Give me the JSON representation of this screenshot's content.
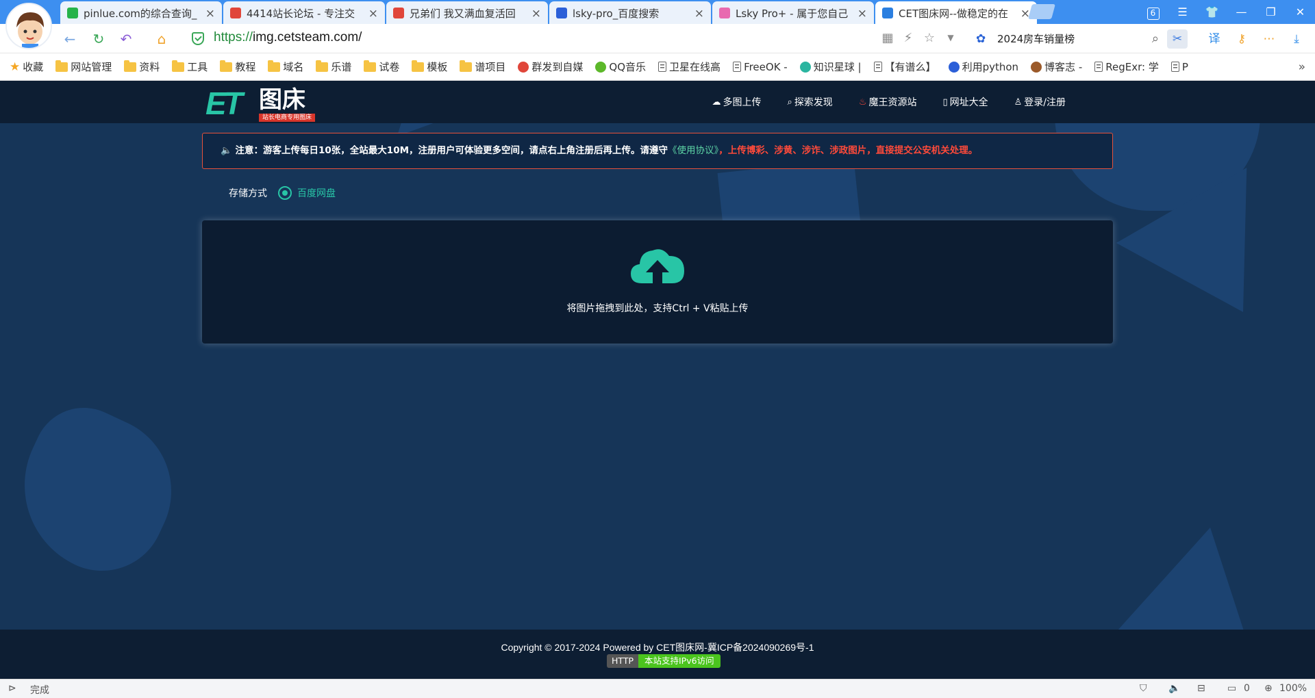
{
  "browser": {
    "tabs": [
      {
        "label": "pinlue.com的综合查询_",
        "icon_color": "#27b34a",
        "active": false
      },
      {
        "label": "4414站长论坛 - 专注交",
        "icon_color": "#e0463a",
        "active": false
      },
      {
        "label": "兄弟们 我又满血复活回",
        "icon_color": "#e0463a",
        "active": false
      },
      {
        "label": "lsky-pro_百度搜索",
        "icon_color": "#2b5fd8",
        "active": false
      },
      {
        "label": "Lsky Pro+ - 属于您自己",
        "icon_color": "#e86ab0",
        "active": false
      },
      {
        "label": "CET图床网--做稳定的在",
        "icon_color": "#2b7fe0",
        "active": true
      }
    ],
    "tab_count_badge": "6",
    "url_scheme": "https://",
    "url_rest": "img.cetsteam.com/",
    "search_suggestion": "2024房车销量榜",
    "bookmarks": [
      {
        "label": "收藏",
        "icon": "star"
      },
      {
        "label": "网站管理",
        "icon": "folder"
      },
      {
        "label": "资料",
        "icon": "folder"
      },
      {
        "label": "工具",
        "icon": "folder"
      },
      {
        "label": "教程",
        "icon": "folder"
      },
      {
        "label": "域名",
        "icon": "folder"
      },
      {
        "label": "乐谱",
        "icon": "folder"
      },
      {
        "label": "试卷",
        "icon": "folder"
      },
      {
        "label": "模板",
        "icon": "folder"
      },
      {
        "label": "谱项目",
        "icon": "folder"
      },
      {
        "label": "群发到自媒",
        "icon": "dot-red"
      },
      {
        "label": "QQ音乐",
        "icon": "dot-green"
      },
      {
        "label": "卫星在线高",
        "icon": "doc"
      },
      {
        "label": "FreeOK -",
        "icon": "doc"
      },
      {
        "label": "知识星球 |",
        "icon": "dot-teal"
      },
      {
        "label": "【有谱么】",
        "icon": "doc"
      },
      {
        "label": "利用python",
        "icon": "dot-blue"
      },
      {
        "label": "博客志 -",
        "icon": "dot-brown"
      },
      {
        "label": "RegExr: 学",
        "icon": "doc"
      },
      {
        "label": "P",
        "icon": "doc"
      }
    ],
    "status_text": "完成",
    "status_count": "0",
    "zoom": "100%"
  },
  "site": {
    "logo_text": "图床",
    "logo_mark": "ET",
    "logo_tag": "站长电商专用图床",
    "nav": [
      {
        "label": "多图上传",
        "icon": "cloud-upload-icon"
      },
      {
        "label": "探索发现",
        "icon": "search-icon"
      },
      {
        "label": "魔王资源站",
        "icon": "fire-icon"
      },
      {
        "label": "网址大全",
        "icon": "phone-icon"
      },
      {
        "label": "登录/注册",
        "icon": "user-icon"
      }
    ],
    "notice": {
      "prefix": "注意：",
      "body": "游客上传每日10张，全站最大10M，注册用户可体验更多空间，请点右上角注册后再上传。请遵守",
      "link": "《使用协议》",
      "sep": "，",
      "warning": "上传博彩、涉黄、涉诈、涉政图片，直接提交公安机关处理。"
    },
    "storage_label": "存储方式",
    "storage_option": "百度网盘",
    "drop_text": "将图片拖拽到此处，支持Ctrl + V粘贴上传",
    "footer_copyright": "Copyright © 2017-2024 Powered by CET图床网-冀ICP备2024090269号-1",
    "badge_left": "HTTP",
    "badge_right": "本站支持IPv6访问"
  },
  "colors": {
    "accent": "#28c5a6",
    "warning": "#ff4a3a",
    "page_bg": "#163558",
    "nav_bg": "#0d1e33"
  }
}
